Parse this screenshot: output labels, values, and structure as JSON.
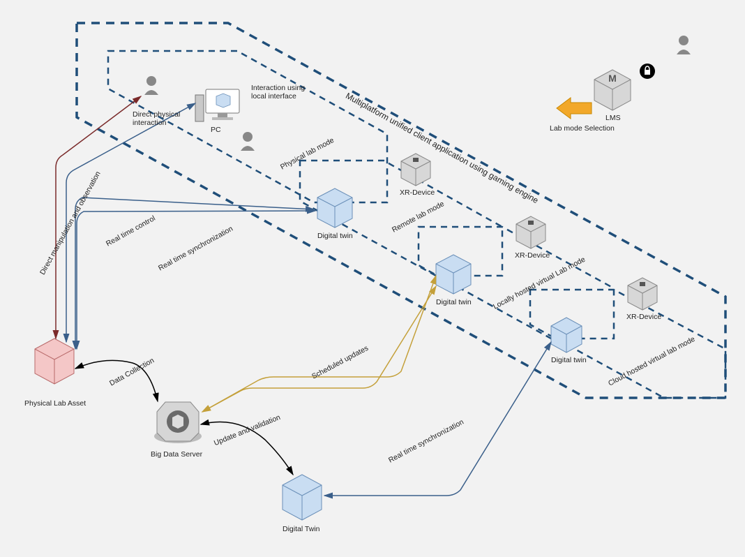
{
  "title": "Multiplatform unified client application using gaming engine",
  "nodes": {
    "physicalLabAsset": "Physical Lab Asset",
    "bigDataServer": "Big Data Server",
    "digitalTwinBottom": "Digital Twin",
    "digitalTwin1": "Digital twin",
    "digitalTwin2": "Digital twin",
    "digitalTwin3": "Digital twin",
    "xrDevice1": "XR-Device",
    "xrDevice2": "XR-Device",
    "xrDevice3": "XR-Device",
    "pc": "PC",
    "lms": "LMS",
    "labModeSelection": "Lab mode Selection"
  },
  "edges": {
    "directManipulation": "Direct manipulation and observation",
    "realTimeControl": "Real time control",
    "realTimeSync1": "Real time synchronization",
    "realTimeSync2": "Real time synchronization",
    "scheduledUpdates": "Scheduled updates",
    "dataCollection": "Data Collection",
    "updateValidation": "Update and validation",
    "directPhysical": "Direct physical interaction",
    "interactionLocal": "Interaction using local interface"
  },
  "modes": {
    "physical": "Physical  lab mode",
    "remote": "Remote lab mode",
    "localHosted": "Locally hosted virtual Lab mode",
    "cloudHosted": "Cloud hosted virtual lab mode"
  }
}
